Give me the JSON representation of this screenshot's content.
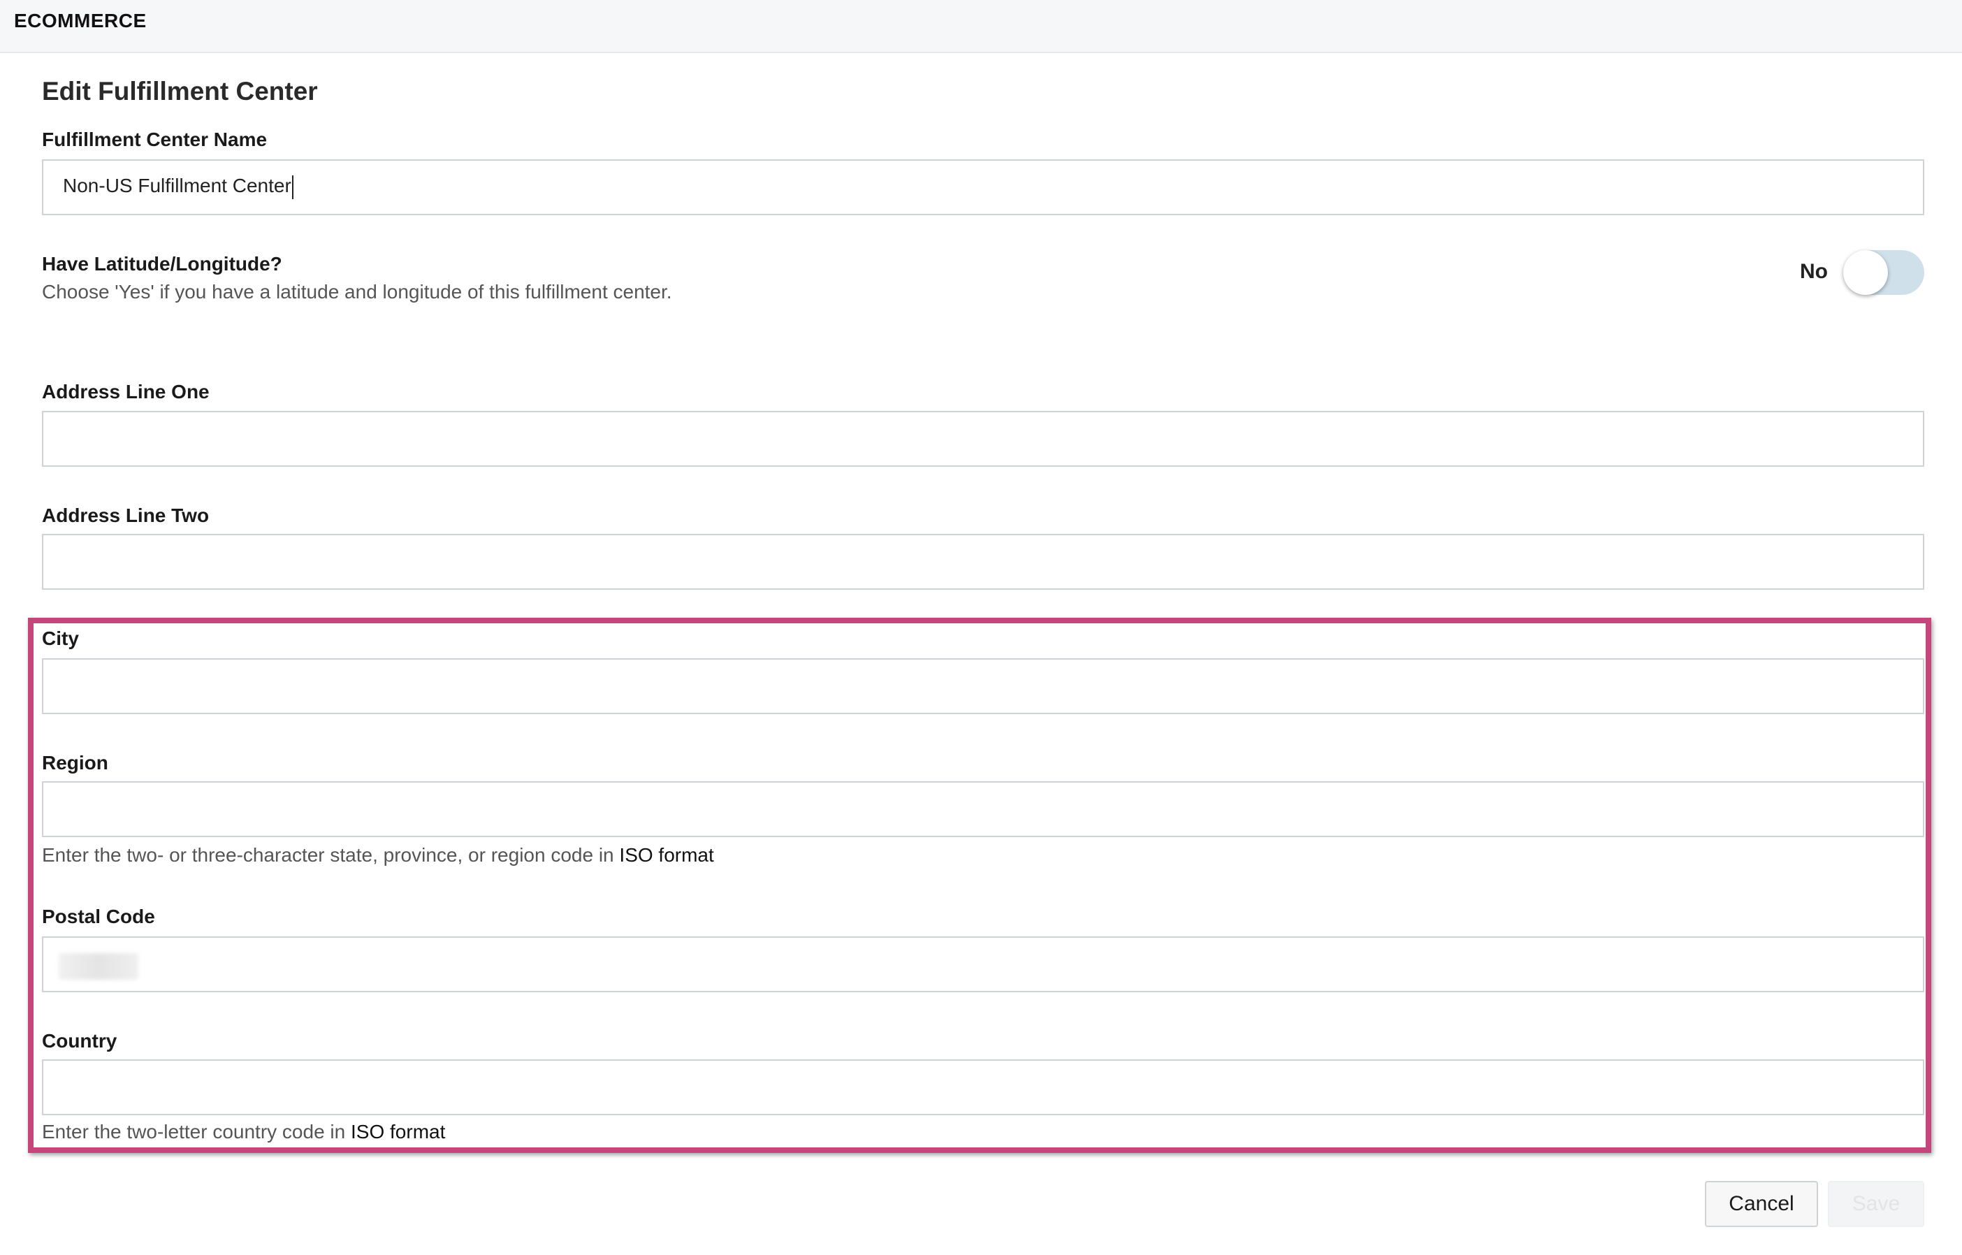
{
  "app": {
    "title": "ECOMMERCE"
  },
  "page": {
    "title": "Edit Fulfillment Center"
  },
  "form": {
    "name": {
      "label": "Fulfillment Center Name",
      "value": "Non-US Fulfillment Center"
    },
    "latlong": {
      "label": "Have Latitude/Longitude?",
      "help": "Choose 'Yes' if you have a latitude and longitude of this fulfillment center.",
      "toggle_label": "No",
      "enabled": false
    },
    "address_one": {
      "label": "Address Line One",
      "value": ""
    },
    "address_two": {
      "label": "Address Line Two",
      "value": ""
    },
    "city": {
      "label": "City",
      "value": ""
    },
    "region": {
      "label": "Region",
      "value": "",
      "help": "Enter the two- or three-character state, province, or region code in ",
      "help_link": "ISO format"
    },
    "postal_code": {
      "label": "Postal Code",
      "value": ""
    },
    "country": {
      "label": "Country",
      "value": "",
      "help": "Enter the two-letter country code in ",
      "help_link": "ISO format"
    }
  },
  "actions": {
    "cancel_label": "Cancel",
    "save_label": "Save"
  },
  "colors": {
    "highlight_border": "#c5467a",
    "toggle_track": "#cfe0ea"
  }
}
